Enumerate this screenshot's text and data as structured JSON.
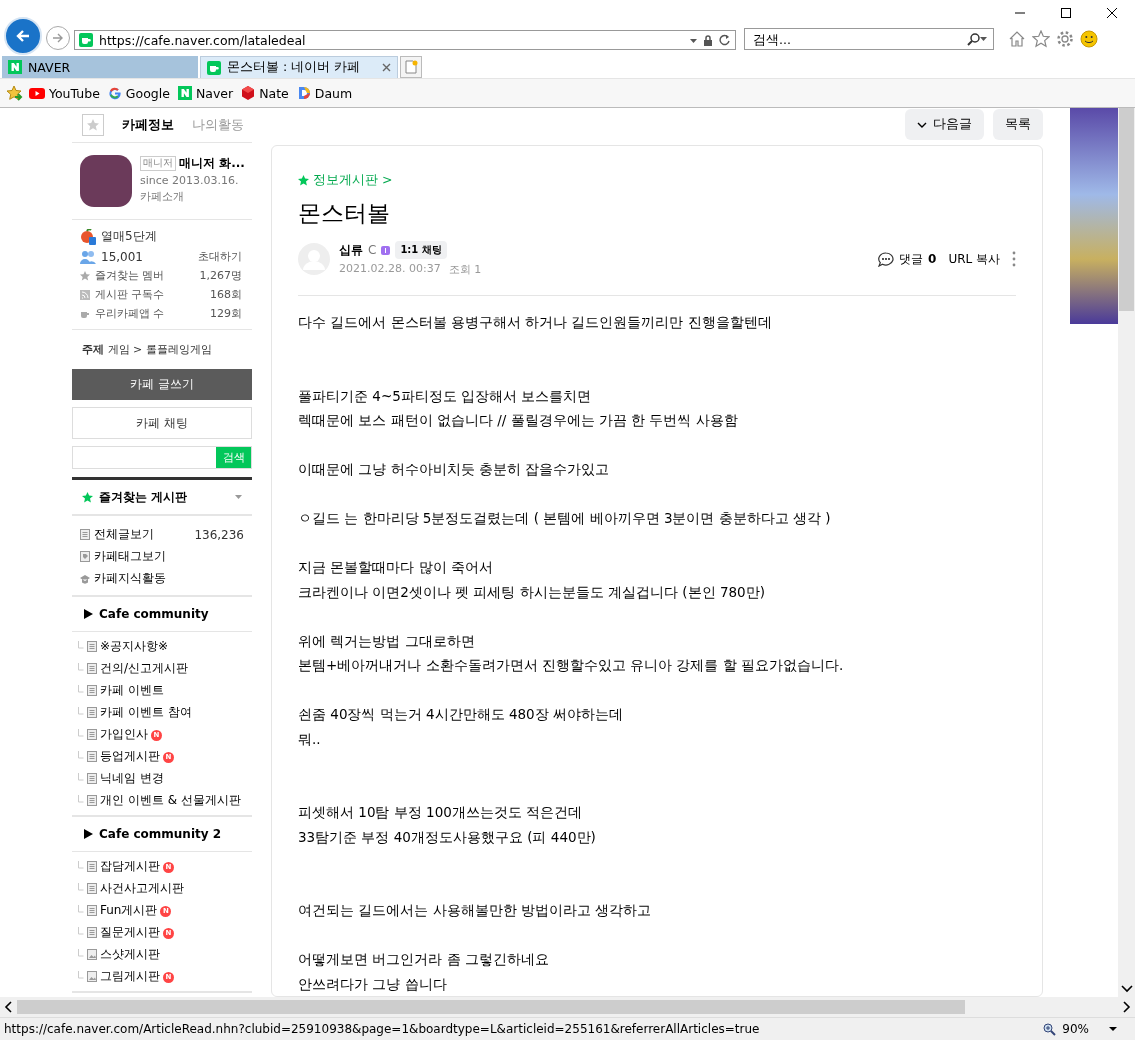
{
  "address_bar": {
    "url": "https://cafe.naver.com/lataledeal"
  },
  "search_box": {
    "placeholder": "검색..."
  },
  "tabs": [
    {
      "label": "NAVER",
      "selected": false,
      "kind": "naver"
    },
    {
      "label": "몬스터볼 : 네이버 카페",
      "selected": true,
      "kind": "cafe"
    }
  ],
  "favorites": [
    {
      "label": "YouTube",
      "kind": "youtube"
    },
    {
      "label": "Google",
      "kind": "google"
    },
    {
      "label": "Naver",
      "kind": "naver"
    },
    {
      "label": "Nate",
      "kind": "nate"
    },
    {
      "label": "Daum",
      "kind": "daum"
    }
  ],
  "sidebar": {
    "tabs": [
      {
        "label": "카페정보",
        "selected": true
      },
      {
        "label": "나의활동",
        "selected": false
      }
    ],
    "cafe": {
      "role_badge": "매니저",
      "manager": "매니저 화...",
      "since": "since 2013.03.16.",
      "intro_link": "카페소개"
    },
    "level": "열매5단계",
    "members": "15,001",
    "invite": "초대하기",
    "stats": [
      {
        "kind": "star",
        "label": "즐겨찾는 멤버",
        "value": "1,267명"
      },
      {
        "kind": "rss",
        "label": "게시판 구독수",
        "value": "168회"
      },
      {
        "kind": "cup",
        "label": "우리카페앱 수",
        "value": "129회"
      }
    ],
    "topic": {
      "label": "주제",
      "path": "게임 > 롤플레잉게임"
    },
    "write_button": "카페 글쓰기",
    "chat_button": "카페 채팅",
    "search_button": "검색",
    "favorite_boards_title": "즐겨찾는 게시판",
    "menu_links": [
      {
        "kind": "doc",
        "label": "전체글보기",
        "count": "136,236"
      },
      {
        "kind": "tag",
        "label": "카페태그보기"
      },
      {
        "kind": "hat",
        "label": "카페지식활동"
      }
    ],
    "groups": [
      {
        "title": "Cafe community",
        "boards": [
          {
            "kind": "doc",
            "label": "※공지사항※"
          },
          {
            "kind": "doc",
            "label": "건의/신고게시판"
          },
          {
            "kind": "doc",
            "label": "카페 이벤트"
          },
          {
            "kind": "doc",
            "label": "카페 이벤트 참여"
          },
          {
            "kind": "doc",
            "label": "가입인사",
            "badge": "N"
          },
          {
            "kind": "doc",
            "label": "등업게시판",
            "badge": "N"
          },
          {
            "kind": "doc",
            "label": "닉네임 변경"
          },
          {
            "kind": "doc",
            "label": "개인 이벤트 & 선물게시판"
          }
        ]
      },
      {
        "title": "Cafe community 2",
        "boards": [
          {
            "kind": "doc",
            "label": "잡담게시판",
            "badge": "N"
          },
          {
            "kind": "doc",
            "label": "사건사고게시판"
          },
          {
            "kind": "doc",
            "label": "Fun게시판",
            "badge": "N"
          },
          {
            "kind": "doc",
            "label": "질문게시판",
            "badge": "N"
          },
          {
            "kind": "image",
            "label": "스샷게시판"
          },
          {
            "kind": "image",
            "label": "그림게시판",
            "badge": "N"
          }
        ]
      }
    ]
  },
  "article": {
    "next_button": "다음글",
    "list_button": "목록",
    "board_link": "정보게시판 >",
    "title": "몬스터볼",
    "author": "십류",
    "author_grade": "C",
    "chat_badge": "1:1 채팅",
    "date": "2021.02.28. 00:37",
    "views": "조회 1",
    "comment_label": "댓글",
    "comment_count": "0",
    "url_copy": "URL 복사",
    "paragraphs": [
      {
        "kind": "lead",
        "lines": [
          "다수 길드에서 몬스터볼 용병구해서 하거나 길드인원들끼리만 진행을할텐데"
        ]
      },
      {
        "kind": "gapped",
        "lines": [
          "풀파티기준 4~5파티정도 입장해서 보스를치면",
          "렉때문에 보스 패턴이 없습니다 // 풀릴경우에는 가끔 한 두번씩 사용함"
        ]
      },
      {
        "kind": "spaced",
        "lines": [
          "이때문에 그냥 허수아비치듯 충분히 잡을수가있고"
        ]
      },
      {
        "kind": "spaced",
        "lines": [
          "ㅇ길드 는 한마리당 5분정도걸렸는데 ( 본템에 베아끼우면 3분이면 충분하다고 생각 )"
        ]
      },
      {
        "kind": "spaced",
        "lines": [
          "지금 몬볼할때마다 많이 죽어서",
          "크라켄이나 이면2셋이나 펫 피세팅 하시는분들도 계실겁니다 (본인 780만)"
        ]
      },
      {
        "kind": "spaced",
        "lines": [
          "위에 렉거는방법 그대로하면",
          "본템+베아꺼내거나 소환수돌려가면서 진행할수있고 유니아 강제를 할 필요가없습니다."
        ]
      },
      {
        "kind": "spaced",
        "lines": [
          "쇤줌 40장씩 먹는거 4시간만해도 480장 써야하는데",
          "뭐.."
        ]
      },
      {
        "kind": "gapped",
        "lines": [
          "피셋해서 10탐 부정 100개쓰는것도 적은건데",
          "33탐기준 부정 40개정도사용했구요 (피 440만)"
        ]
      },
      {
        "kind": "gapped",
        "lines": [
          "여건되는 길드에서는 사용해볼만한 방법이라고 생각하고"
        ]
      },
      {
        "kind": "spaced",
        "lines": [
          "어떻게보면 버그인거라 좀 그렇긴하네요",
          "안쓰려다가 그냥 씁니다"
        ]
      }
    ]
  },
  "status_bar": {
    "url": "https://cafe.naver.com/ArticleRead.nhn?clubid=25910938&page=1&boardtype=L&articleid=255161&referrerAllArticles=true",
    "zoom": "90%"
  }
}
